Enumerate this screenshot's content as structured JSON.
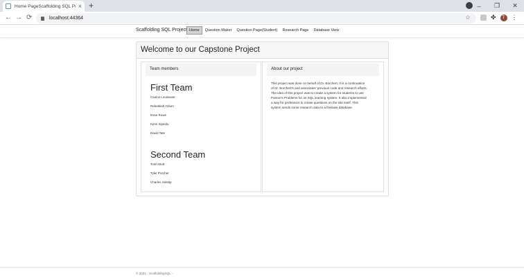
{
  "browser": {
    "tab_title": "Home PageScaffolding SQL Proj",
    "tab_close": "×",
    "new_tab": "+",
    "url": "localhost:44364",
    "nav_back": "←",
    "nav_forward": "→",
    "nav_reload": "⟳",
    "star": "☆",
    "win_minimize": "–",
    "win_maximize": "❐",
    "win_close": "✕",
    "profile_initial": "T",
    "puzzle": "✤",
    "kebab": "⋮"
  },
  "navbar": {
    "brand": "Scaffolding SQL Project",
    "links": [
      "Home",
      "Question Maker",
      "Question Page(Student)",
      "Research Page",
      "Database View"
    ],
    "active_index": 0
  },
  "card": {
    "title": "Welcome to our Capstone Project"
  },
  "team_panel": {
    "heading": "Team members",
    "teams": [
      {
        "title": "First Team",
        "members": [
          "Caulos Louissaint",
          "Rebekkah Odum",
          "Evan Rowe",
          "Kemi Sipeolu",
          "David Tate"
        ]
      },
      {
        "title": "Second Team",
        "members": [
          "Torin Stott",
          "Tyler Porcher",
          "Charles Halstip"
        ]
      }
    ]
  },
  "about_panel": {
    "heading": "About our project",
    "lines": [
      "This project was done on behalf of Dr. Borchert. It is a continuation",
      "of Dr. Borchert's and associates' previous code and research efforts.",
      "The idea of this project was to create a system for students to use",
      "Parson's Problems for an SQL learning system. It also implemented",
      "a way for professors to create questions on the site itself. This",
      "system sends some research data to a firebase database."
    ]
  },
  "footer": {
    "text": "© 2021 - ScaffoldingSQL -"
  },
  "colors": {
    "tabstrip": "#dee1e6",
    "active_nav_bg": "#d3d3d3",
    "card_header_bg": "#f7f7f7"
  }
}
